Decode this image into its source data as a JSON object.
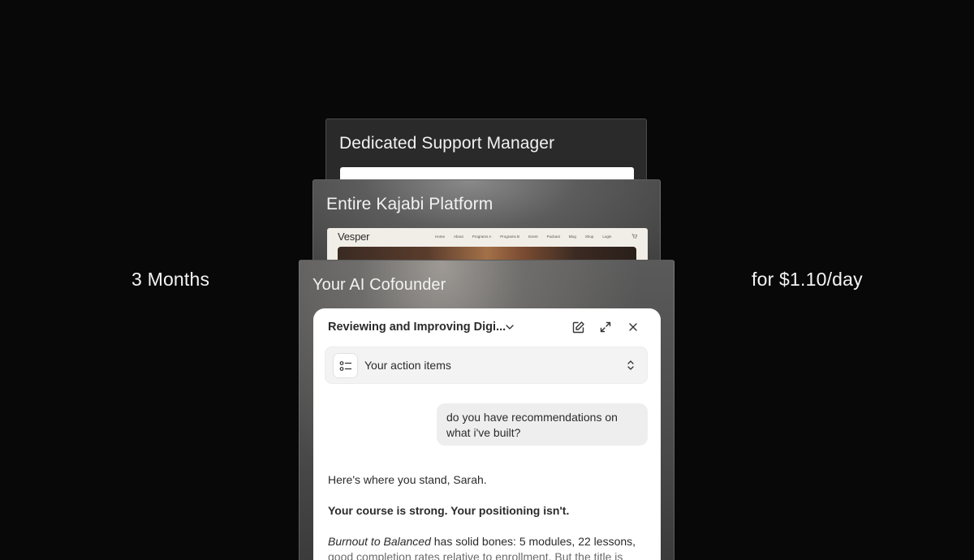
{
  "side": {
    "left_label": "3 Months",
    "right_label": "for $1.10/day"
  },
  "cards": {
    "support": {
      "title": "Dedicated Support Manager"
    },
    "platform": {
      "title": "Entire Kajabi Platform",
      "site": {
        "logo": "Vesper",
        "nav": [
          "Home",
          "About",
          "Programs A",
          "Programs B",
          "Event",
          "Podcast",
          "Blog",
          "Shop",
          "Login"
        ]
      }
    },
    "cofounder": {
      "title": "Your AI Cofounder"
    }
  },
  "chat": {
    "conversation_title": "Reviewing and Improving Digi...",
    "action_items_label": "Your action items",
    "user_message": "do you have recommendations on what i've built?",
    "reply": {
      "greeting": "Here's where you stand, Sarah.",
      "headline": "Your course is strong. Your positioning isn't.",
      "course_name": "Burnout to Balanced",
      "body_line1": " has solid bones: 5 modules, 22 lessons,",
      "body_line2": "good completion rates relative to enrollment. But the title is"
    }
  },
  "icons": {
    "chevron": "chevron-down-icon",
    "edit": "edit-icon",
    "expand": "expand-icon",
    "close": "close-icon",
    "list": "list-icon",
    "sort": "sort-icon",
    "cart": "cart-icon"
  }
}
